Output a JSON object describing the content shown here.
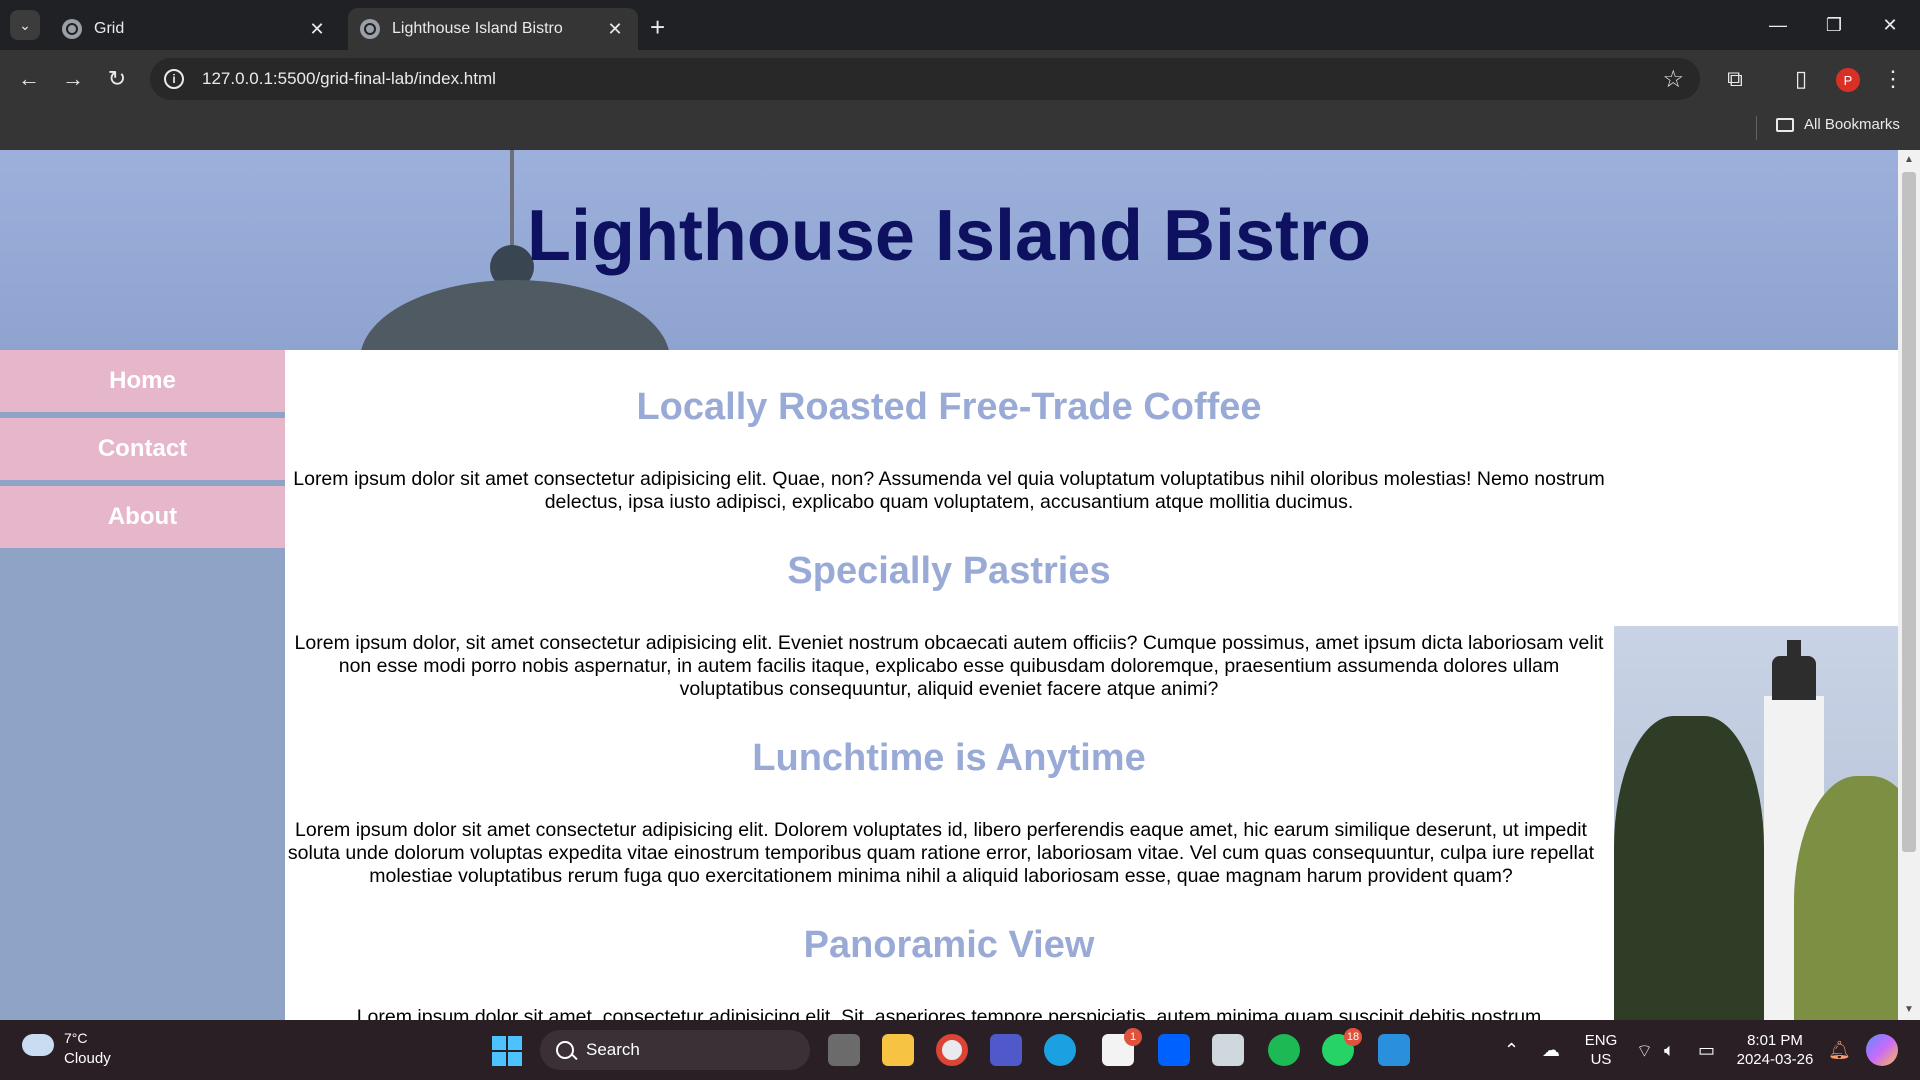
{
  "browser": {
    "tabs": [
      {
        "title": "Grid"
      },
      {
        "title": "Lighthouse Island Bistro"
      }
    ],
    "url": "127.0.0.1:5500/grid-final-lab/index.html",
    "profile_initial": "P",
    "bookmarks_label": "All Bookmarks"
  },
  "page": {
    "site_title": "Lighthouse Island Bistro",
    "nav": [
      "Home",
      "Contact",
      "About"
    ],
    "sections": [
      {
        "heading": "Locally Roasted Free-Trade Coffee",
        "text": "Lorem ipsum dolor sit amet consectetur adipisicing elit. Quae, non? Assumenda vel quia voluptatum voluptatibus nihil oloribus molestias! Nemo nostrum delectus, ipsa iusto adipisci, explicabo quam voluptatem, accusantium atque mollitia ducimus."
      },
      {
        "heading": "Specially Pastries",
        "text": "Lorem ipsum dolor, sit amet consectetur adipisicing elit. Eveniet nostrum obcaecati autem officiis? Cumque possimus, amet ipsum dicta laboriosam velit non esse modi porro nobis aspernatur, in autem facilis itaque, explicabo esse quibusdam doloremque, praesentium assumenda dolores ullam voluptatibus consequuntur, aliquid eveniet facere atque animi?"
      },
      {
        "heading": "Lunchtime is Anytime",
        "text": "Lorem ipsum dolor sit amet consectetur adipisicing elit. Dolorem voluptates id, libero perferendis eaque amet, hic earum similique deserunt, ut impedit soluta unde dolorum voluptas expedita vitae einostrum temporibus quam ratione error, laboriosam vitae. Vel cum quas consequuntur, culpa iure repellat molestiae voluptatibus rerum fuga quo exercitationem minima nihil a aliquid laboriosam esse, quae magnam harum provident quam?"
      },
      {
        "heading": "Panoramic View",
        "text": "Lorem ipsum dolor sit amet, consectetur adipisicing elit. Sit, asperiores tempore perspiciatis, autem minima quam suscipit debitis nostrum"
      }
    ]
  },
  "taskbar": {
    "weather_temp": "7°C",
    "weather_desc": "Cloudy",
    "search_label": "Search",
    "badges": {
      "store": "1",
      "whatsapp": "18"
    },
    "lang_top": "ENG",
    "lang_bottom": "US",
    "time": "8:01 PM",
    "date": "2024-03-26"
  },
  "colors": {
    "header_bg": "#9db0dc",
    "title": "#0e1060",
    "nav_bg": "#e6b6cb",
    "sidebar_bg": "#8fa3c7",
    "heading": "#9aaad6"
  }
}
